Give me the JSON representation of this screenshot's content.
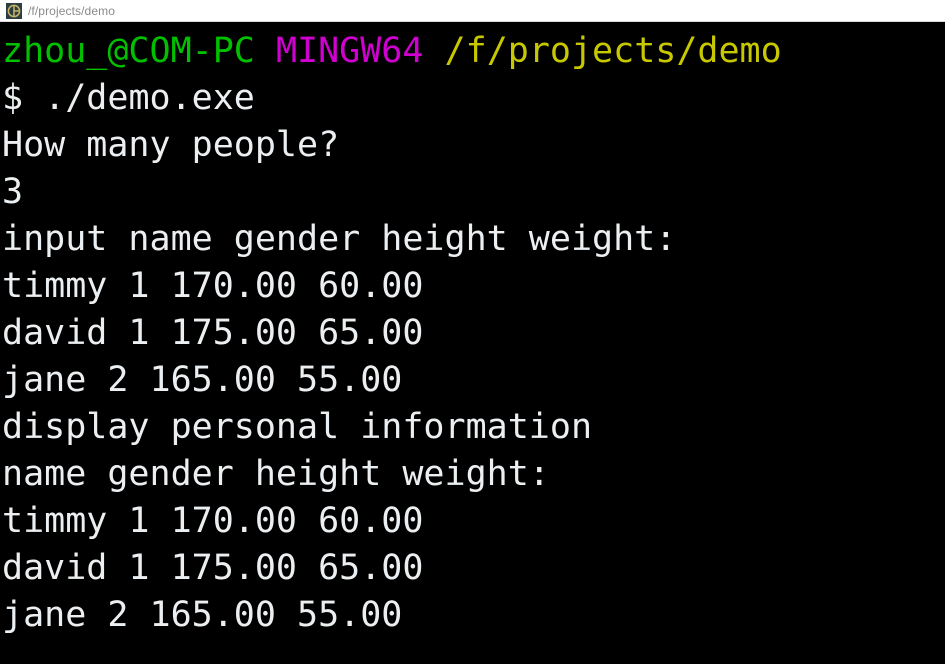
{
  "window": {
    "title": "/f/projects/demo",
    "icon": "git-bash-icon"
  },
  "colors": {
    "background": "#000000",
    "foreground": "#eceff1",
    "user_host": "#00c000",
    "shell_name": "#d000d0",
    "path": "#c8c800",
    "titlebar_bg": "#ffffff",
    "titlebar_text": "#8a8a8a"
  },
  "terminal": {
    "prompt": {
      "user_host": "zhou_@COM-PC",
      "shell": "MINGW64",
      "path": "/f/projects/demo"
    },
    "command_line": {
      "sigil": "$",
      "command": "./demo.exe"
    },
    "output": [
      "How many people?",
      "3",
      "input name gender height weight:",
      "timmy 1 170.00 60.00",
      "david 1 175.00 65.00",
      "jane 2 165.00 55.00",
      "display personal information",
      "name gender height weight:",
      "timmy 1 170.00 60.00",
      "david 1 175.00 65.00",
      "jane 2 165.00 55.00"
    ]
  }
}
